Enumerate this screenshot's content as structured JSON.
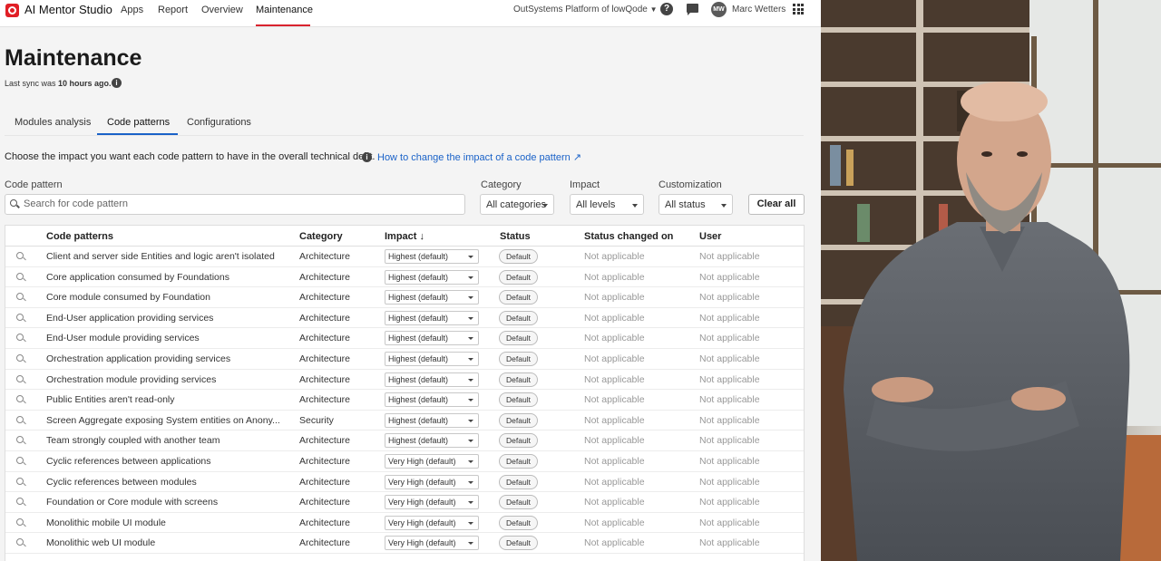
{
  "topbar": {
    "brand": "AI Mentor Studio",
    "nav": [
      "Apps",
      "Report",
      "Overview",
      "Maintenance"
    ],
    "platform": "OutSystems Platform of lowQode",
    "user_initials": "MW",
    "user_name": "Marc Wetters"
  },
  "page": {
    "title": "Maintenance",
    "sync_prefix": "Last sync was ",
    "sync_value": "10 hours ago.",
    "tabs": [
      "Modules analysis",
      "Code patterns",
      "Configurations"
    ],
    "active_tab": "Code patterns",
    "description": "Choose the impact you want each code pattern to have in the overall technical debt.",
    "help_link": "How to change the impact of a code pattern"
  },
  "filters": {
    "code_pattern_label": "Code pattern",
    "search_placeholder": "Search for code pattern",
    "category_label": "Category",
    "category_value": "All categories",
    "impact_label": "Impact",
    "impact_value": "All levels",
    "customization_label": "Customization",
    "customization_value": "All status",
    "clear_label": "Clear all"
  },
  "table": {
    "columns": [
      "Code patterns",
      "Category",
      "Impact",
      "Status",
      "Status changed on",
      "User"
    ],
    "rows": [
      {
        "pattern": "Client and server side Entities and logic aren't isolated",
        "category": "Architecture",
        "impact": "Highest (default)",
        "status": "Default",
        "changed": "Not applicable",
        "user": "Not applicable"
      },
      {
        "pattern": "Core application consumed by Foundations",
        "category": "Architecture",
        "impact": "Highest (default)",
        "status": "Default",
        "changed": "Not applicable",
        "user": "Not applicable"
      },
      {
        "pattern": "Core module consumed by Foundation",
        "category": "Architecture",
        "impact": "Highest (default)",
        "status": "Default",
        "changed": "Not applicable",
        "user": "Not applicable"
      },
      {
        "pattern": "End-User application providing services",
        "category": "Architecture",
        "impact": "Highest (default)",
        "status": "Default",
        "changed": "Not applicable",
        "user": "Not applicable"
      },
      {
        "pattern": "End-User module providing services",
        "category": "Architecture",
        "impact": "Highest (default)",
        "status": "Default",
        "changed": "Not applicable",
        "user": "Not applicable"
      },
      {
        "pattern": "Orchestration application providing services",
        "category": "Architecture",
        "impact": "Highest (default)",
        "status": "Default",
        "changed": "Not applicable",
        "user": "Not applicable"
      },
      {
        "pattern": "Orchestration module providing services",
        "category": "Architecture",
        "impact": "Highest (default)",
        "status": "Default",
        "changed": "Not applicable",
        "user": "Not applicable"
      },
      {
        "pattern": "Public Entities aren't read-only",
        "category": "Architecture",
        "impact": "Highest (default)",
        "status": "Default",
        "changed": "Not applicable",
        "user": "Not applicable"
      },
      {
        "pattern": "Screen Aggregate exposing System entities on Anony...",
        "category": "Security",
        "impact": "Highest (default)",
        "status": "Default",
        "changed": "Not applicable",
        "user": "Not applicable"
      },
      {
        "pattern": "Team strongly coupled with another team",
        "category": "Architecture",
        "impact": "Highest (default)",
        "status": "Default",
        "changed": "Not applicable",
        "user": "Not applicable"
      },
      {
        "pattern": "Cyclic references between applications",
        "category": "Architecture",
        "impact": "Very High (default)",
        "status": "Default",
        "changed": "Not applicable",
        "user": "Not applicable"
      },
      {
        "pattern": "Cyclic references between modules",
        "category": "Architecture",
        "impact": "Very High (default)",
        "status": "Default",
        "changed": "Not applicable",
        "user": "Not applicable"
      },
      {
        "pattern": "Foundation or Core module with screens",
        "category": "Architecture",
        "impact": "Very High (default)",
        "status": "Default",
        "changed": "Not applicable",
        "user": "Not applicable"
      },
      {
        "pattern": "Monolithic mobile UI module",
        "category": "Architecture",
        "impact": "Very High (default)",
        "status": "Default",
        "changed": "Not applicable",
        "user": "Not applicable"
      },
      {
        "pattern": "Monolithic web UI module",
        "category": "Architecture",
        "impact": "Very High (default)",
        "status": "Default",
        "changed": "Not applicable",
        "user": "Not applicable"
      }
    ]
  },
  "colors": {
    "brand_red": "#e11f26",
    "link_blue": "#1a62c8",
    "tab_underline": "#1a62c8",
    "nav_underline": "#d9232e"
  }
}
